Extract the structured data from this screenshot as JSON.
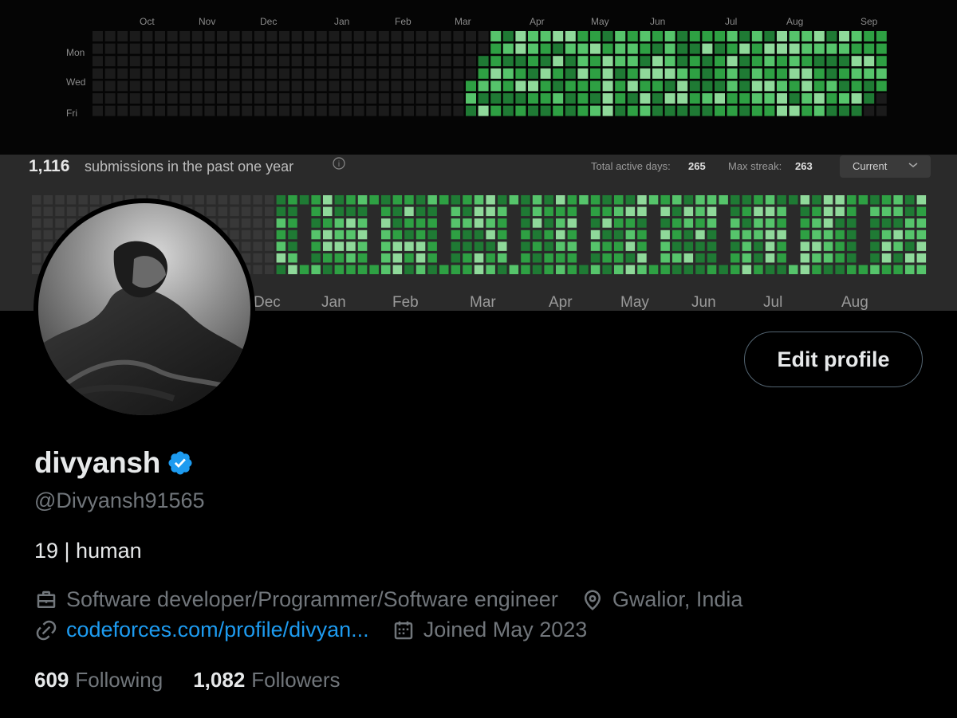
{
  "banner": {
    "top_calendar": {
      "months": [
        "Oct",
        "Nov",
        "Dec",
        "Jan",
        "Feb",
        "Mar",
        "Apr",
        "May",
        "Jun",
        "Jul",
        "Aug",
        "Sep"
      ],
      "weekdays": [
        "Mon",
        "Wed",
        "Fri"
      ]
    },
    "stats_bar": {
      "submissions_count": "1,116",
      "submissions_text": "submissions in the past one year",
      "active_days_label": "Total active days:",
      "active_days_value": "265",
      "max_streak_label": "Max streak:",
      "max_streak_value": "263",
      "period_select": "Current"
    },
    "bottom_calendar": {
      "months": [
        "Dec",
        "Jan",
        "Feb",
        "Mar",
        "Apr",
        "May",
        "Jun",
        "Jul",
        "Aug"
      ]
    },
    "colors": {
      "empty": "#1f1f1f",
      "green_dark": "#1f7a34",
      "green": "#2ea043",
      "green_light": "#56c46b",
      "green_pale": "#8fd99a"
    }
  },
  "profile": {
    "edit_button": "Edit profile",
    "display_name": "divyansh",
    "handle": "@Divyansh91565",
    "bio": "19 | human",
    "profession": "Software developer/Programmer/Software engineer",
    "location": "Gwalior, India",
    "website": "codeforces.com/profile/divyan...",
    "joined": "Joined May 2023",
    "following_count": "609",
    "following_label": "Following",
    "followers_count": "1,082",
    "followers_label": "Followers",
    "icons": [
      "briefcase-icon",
      "location-pin-icon",
      "link-icon",
      "calendar-icon",
      "verified-badge-icon"
    ],
    "verified_color": "#1d9bf0"
  }
}
